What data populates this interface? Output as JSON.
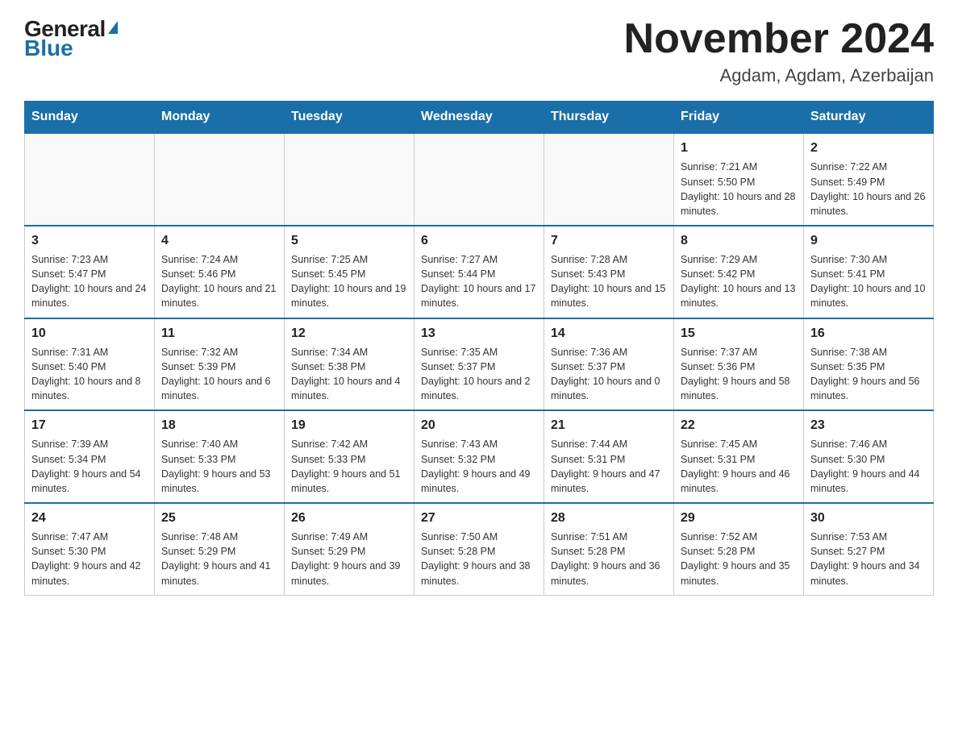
{
  "header": {
    "logo_general": "General",
    "logo_blue": "Blue",
    "month_title": "November 2024",
    "location": "Agdam, Agdam, Azerbaijan"
  },
  "days_of_week": [
    "Sunday",
    "Monday",
    "Tuesday",
    "Wednesday",
    "Thursday",
    "Friday",
    "Saturday"
  ],
  "weeks": [
    [
      {
        "day": "",
        "info": ""
      },
      {
        "day": "",
        "info": ""
      },
      {
        "day": "",
        "info": ""
      },
      {
        "day": "",
        "info": ""
      },
      {
        "day": "",
        "info": ""
      },
      {
        "day": "1",
        "info": "Sunrise: 7:21 AM\nSunset: 5:50 PM\nDaylight: 10 hours and 28 minutes."
      },
      {
        "day": "2",
        "info": "Sunrise: 7:22 AM\nSunset: 5:49 PM\nDaylight: 10 hours and 26 minutes."
      }
    ],
    [
      {
        "day": "3",
        "info": "Sunrise: 7:23 AM\nSunset: 5:47 PM\nDaylight: 10 hours and 24 minutes."
      },
      {
        "day": "4",
        "info": "Sunrise: 7:24 AM\nSunset: 5:46 PM\nDaylight: 10 hours and 21 minutes."
      },
      {
        "day": "5",
        "info": "Sunrise: 7:25 AM\nSunset: 5:45 PM\nDaylight: 10 hours and 19 minutes."
      },
      {
        "day": "6",
        "info": "Sunrise: 7:27 AM\nSunset: 5:44 PM\nDaylight: 10 hours and 17 minutes."
      },
      {
        "day": "7",
        "info": "Sunrise: 7:28 AM\nSunset: 5:43 PM\nDaylight: 10 hours and 15 minutes."
      },
      {
        "day": "8",
        "info": "Sunrise: 7:29 AM\nSunset: 5:42 PM\nDaylight: 10 hours and 13 minutes."
      },
      {
        "day": "9",
        "info": "Sunrise: 7:30 AM\nSunset: 5:41 PM\nDaylight: 10 hours and 10 minutes."
      }
    ],
    [
      {
        "day": "10",
        "info": "Sunrise: 7:31 AM\nSunset: 5:40 PM\nDaylight: 10 hours and 8 minutes."
      },
      {
        "day": "11",
        "info": "Sunrise: 7:32 AM\nSunset: 5:39 PM\nDaylight: 10 hours and 6 minutes."
      },
      {
        "day": "12",
        "info": "Sunrise: 7:34 AM\nSunset: 5:38 PM\nDaylight: 10 hours and 4 minutes."
      },
      {
        "day": "13",
        "info": "Sunrise: 7:35 AM\nSunset: 5:37 PM\nDaylight: 10 hours and 2 minutes."
      },
      {
        "day": "14",
        "info": "Sunrise: 7:36 AM\nSunset: 5:37 PM\nDaylight: 10 hours and 0 minutes."
      },
      {
        "day": "15",
        "info": "Sunrise: 7:37 AM\nSunset: 5:36 PM\nDaylight: 9 hours and 58 minutes."
      },
      {
        "day": "16",
        "info": "Sunrise: 7:38 AM\nSunset: 5:35 PM\nDaylight: 9 hours and 56 minutes."
      }
    ],
    [
      {
        "day": "17",
        "info": "Sunrise: 7:39 AM\nSunset: 5:34 PM\nDaylight: 9 hours and 54 minutes."
      },
      {
        "day": "18",
        "info": "Sunrise: 7:40 AM\nSunset: 5:33 PM\nDaylight: 9 hours and 53 minutes."
      },
      {
        "day": "19",
        "info": "Sunrise: 7:42 AM\nSunset: 5:33 PM\nDaylight: 9 hours and 51 minutes."
      },
      {
        "day": "20",
        "info": "Sunrise: 7:43 AM\nSunset: 5:32 PM\nDaylight: 9 hours and 49 minutes."
      },
      {
        "day": "21",
        "info": "Sunrise: 7:44 AM\nSunset: 5:31 PM\nDaylight: 9 hours and 47 minutes."
      },
      {
        "day": "22",
        "info": "Sunrise: 7:45 AM\nSunset: 5:31 PM\nDaylight: 9 hours and 46 minutes."
      },
      {
        "day": "23",
        "info": "Sunrise: 7:46 AM\nSunset: 5:30 PM\nDaylight: 9 hours and 44 minutes."
      }
    ],
    [
      {
        "day": "24",
        "info": "Sunrise: 7:47 AM\nSunset: 5:30 PM\nDaylight: 9 hours and 42 minutes."
      },
      {
        "day": "25",
        "info": "Sunrise: 7:48 AM\nSunset: 5:29 PM\nDaylight: 9 hours and 41 minutes."
      },
      {
        "day": "26",
        "info": "Sunrise: 7:49 AM\nSunset: 5:29 PM\nDaylight: 9 hours and 39 minutes."
      },
      {
        "day": "27",
        "info": "Sunrise: 7:50 AM\nSunset: 5:28 PM\nDaylight: 9 hours and 38 minutes."
      },
      {
        "day": "28",
        "info": "Sunrise: 7:51 AM\nSunset: 5:28 PM\nDaylight: 9 hours and 36 minutes."
      },
      {
        "day": "29",
        "info": "Sunrise: 7:52 AM\nSunset: 5:28 PM\nDaylight: 9 hours and 35 minutes."
      },
      {
        "day": "30",
        "info": "Sunrise: 7:53 AM\nSunset: 5:27 PM\nDaylight: 9 hours and 34 minutes."
      }
    ]
  ]
}
